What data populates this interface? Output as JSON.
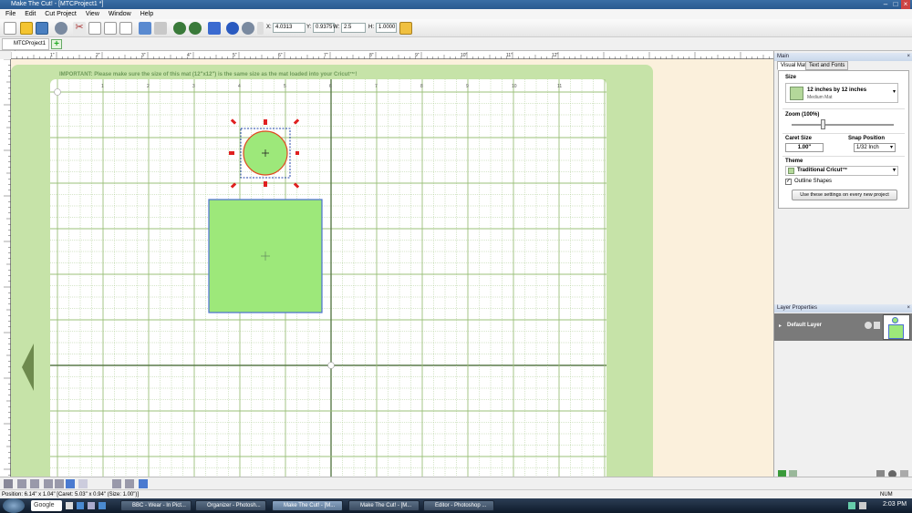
{
  "window": {
    "title": "Make The Cut! - [MTCProject1 *]"
  },
  "menu": [
    "File",
    "Edit",
    "Cut Project",
    "View",
    "Window",
    "Help"
  ],
  "toolbar": {
    "x_label": "X:",
    "x_value": "4.0313",
    "y_label": "Y:",
    "y_value": "0.9375",
    "w_label": "W:",
    "w_value": "2.5",
    "h_label": "H:",
    "h_value": "1.0000"
  },
  "tabs": {
    "project": "MTCProject1 *"
  },
  "ruler": {
    "h_ticks": [
      "1\"",
      "2\"",
      "3\"",
      "4\"",
      "5\"",
      "6\"",
      "7\"",
      "8\"",
      "9\"",
      "10\"",
      "11\"",
      "12\""
    ],
    "mat_ticks": [
      "1",
      "2",
      "3",
      "4",
      "5",
      "6",
      "7",
      "8",
      "9",
      "10",
      "11"
    ]
  },
  "mat": {
    "notice": "IMPORTANT: Please make sure the size of this mat (12\"x12\") is the same size as the mat loaded into your Cricut™!"
  },
  "right_panel": {
    "header": "Main",
    "tabs": [
      "Visual Mat",
      "Text and Fonts"
    ],
    "size_label": "Size",
    "size_value": "12 inches by 12 inches",
    "size_sub": "Medium Mat",
    "zoom_label": "Zoom (100%)",
    "caret_label": "Caret Size",
    "caret_value": "1.00\"",
    "snap_label": "Snap Position",
    "snap_value": "1/32 Inch",
    "theme_label": "Theme",
    "theme_value": "Traditional Cricut™",
    "outline_label": "Outline Shapes",
    "outline_checked": true,
    "apply_button": "Use these settings on every new project"
  },
  "layers": {
    "header": "Layer Properties",
    "default_layer": "Default Layer"
  },
  "status": {
    "position": "Position: 6.14\" x 1.04\" [Caret: 5.03\" x 0.94\" (Size: 1.00\")]",
    "num": "NUM"
  },
  "taskbar": {
    "search": "Google",
    "items": [
      "BBC - Wear - In Pict...",
      "Organizer - Photosh...",
      "Make The Cut! - [M...",
      "Make The Cut! - [M...",
      "Editor - Photoshop ..."
    ],
    "clock": "2:03 PM"
  },
  "colors": {
    "mat": "#c6e3a8",
    "shape_fill": "#9de87a",
    "shape_stroke": "#4a6fd0",
    "handle": "#e02020"
  }
}
